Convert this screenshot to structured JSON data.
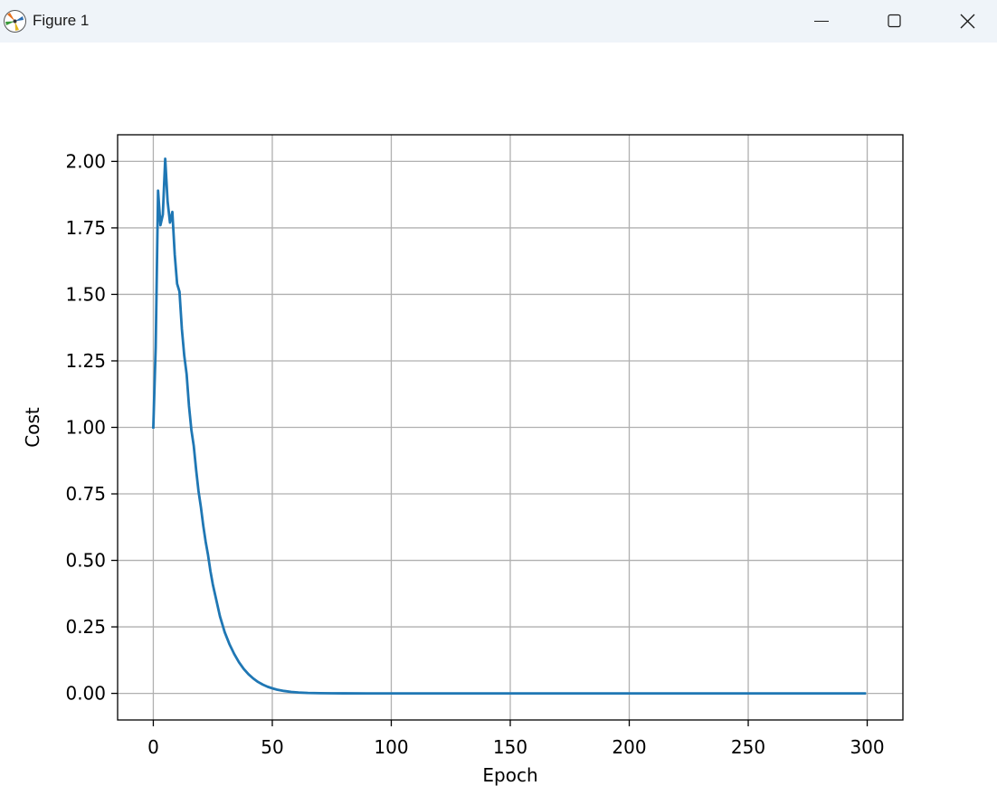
{
  "window": {
    "title": "Figure 1",
    "icons": {
      "app": "matplotlib-logo-icon",
      "minimize": "minimize-icon",
      "maximize": "maximize-icon",
      "close": "close-icon"
    }
  },
  "colors": {
    "line": "#1f77b4",
    "grid": "#b0b0b0",
    "titlebar": "#eff4f9"
  },
  "chart_data": {
    "type": "line",
    "title": "",
    "xlabel": "Epoch",
    "ylabel": "Cost",
    "xlim": [
      -15,
      315
    ],
    "ylim": [
      -0.1,
      2.1
    ],
    "xticks": [
      0,
      50,
      100,
      150,
      200,
      250,
      300
    ],
    "xtick_labels": [
      "0",
      "50",
      "100",
      "150",
      "200",
      "250",
      "300"
    ],
    "yticks": [
      0,
      0.25,
      0.5,
      0.75,
      1.0,
      1.25,
      1.5,
      1.75,
      2.0
    ],
    "ytick_labels": [
      "0.00",
      "0.25",
      "0.50",
      "0.75",
      "1.00",
      "1.25",
      "1.50",
      "1.75",
      "2.00"
    ],
    "grid": true,
    "series": [
      {
        "color": "#1f77b4",
        "x": [
          0,
          1,
          2,
          3,
          4,
          5,
          6,
          7,
          8,
          9,
          10,
          11,
          12,
          13,
          14,
          15,
          16,
          17,
          18,
          19,
          20,
          21,
          22,
          23,
          24,
          25,
          26,
          27,
          28,
          29,
          30,
          32,
          34,
          36,
          38,
          40,
          42,
          44,
          46,
          48,
          50,
          52,
          55,
          58,
          61,
          65,
          70,
          75,
          80,
          90,
          100,
          120,
          150,
          200,
          250,
          299
        ],
        "y": [
          1.0,
          1.3,
          1.89,
          1.76,
          1.8,
          2.01,
          1.85,
          1.77,
          1.81,
          1.65,
          1.54,
          1.51,
          1.37,
          1.27,
          1.2,
          1.08,
          0.99,
          0.93,
          0.84,
          0.76,
          0.7,
          0.63,
          0.57,
          0.52,
          0.46,
          0.41,
          0.37,
          0.33,
          0.29,
          0.26,
          0.23,
          0.185,
          0.148,
          0.117,
          0.092,
          0.072,
          0.056,
          0.043,
          0.033,
          0.025,
          0.019,
          0.014,
          0.009,
          0.0055,
          0.0033,
          0.0017,
          0.0008,
          0.0003,
          0.0001,
          0.0,
          0.0,
          0.0,
          0.0,
          0.0,
          0.0,
          0.0
        ]
      }
    ]
  }
}
